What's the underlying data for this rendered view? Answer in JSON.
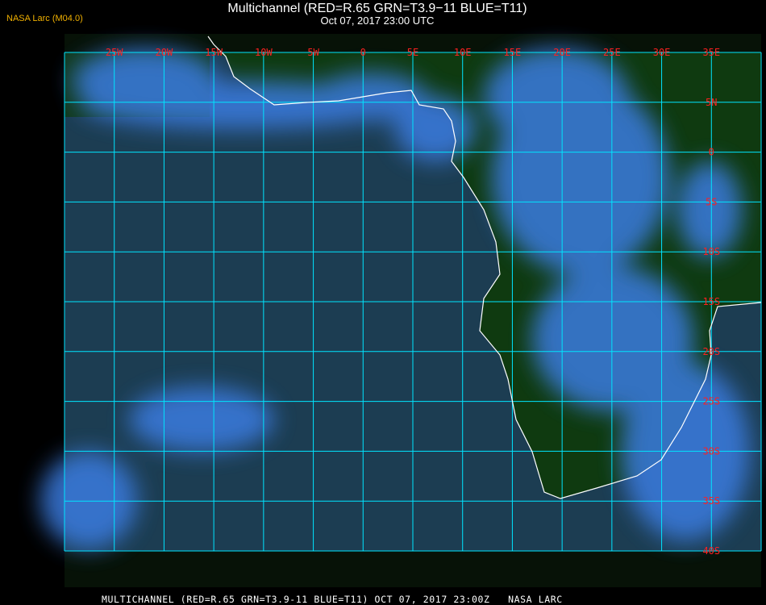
{
  "header": {
    "title": "Multichannel (RED=R.65 GRN=T3.9−11 BLUE=T11)",
    "datetime": "Oct 07, 2017 23:00 UTC",
    "credit": "NASA Larc (M04.0)"
  },
  "footer": "MULTICHANNEL (RED=R.65 GRN=T3.9-11 BLUE=T11) OCT 07, 2017 23:00Z   NASA LARC",
  "map": {
    "lon_range": [
      -30,
      40
    ],
    "lat_range": [
      10,
      -40
    ],
    "grid_color": "#00e5ff",
    "label_color": "#ff2020",
    "coast_color": "#ffffff",
    "land_color": "#0f3a10",
    "ocean_color": "#1c3d52",
    "cloud_color": "#3a7be0",
    "lon_labels": [
      {
        "lon": -25,
        "text": "25W"
      },
      {
        "lon": -20,
        "text": "20W"
      },
      {
        "lon": -15,
        "text": "15W"
      },
      {
        "lon": -10,
        "text": "10W"
      },
      {
        "lon": -5,
        "text": "5W"
      },
      {
        "lon": 0,
        "text": "0"
      },
      {
        "lon": 5,
        "text": "5E"
      },
      {
        "lon": 10,
        "text": "10E"
      },
      {
        "lon": 15,
        "text": "15E"
      },
      {
        "lon": 20,
        "text": "20E"
      },
      {
        "lon": 25,
        "text": "25E"
      },
      {
        "lon": 30,
        "text": "30E"
      },
      {
        "lon": 35,
        "text": "35E"
      }
    ],
    "lat_labels": [
      {
        "lat": 5,
        "text": "5N"
      },
      {
        "lat": 0,
        "text": "0"
      },
      {
        "lat": -5,
        "text": "5S"
      },
      {
        "lat": -10,
        "text": "10S"
      },
      {
        "lat": -15,
        "text": "15S"
      },
      {
        "lat": -20,
        "text": "20S"
      },
      {
        "lat": -25,
        "text": "25S"
      },
      {
        "lat": -30,
        "text": "30S"
      },
      {
        "lat": -35,
        "text": "35S"
      },
      {
        "lat": -40,
        "text": "40S"
      }
    ]
  }
}
